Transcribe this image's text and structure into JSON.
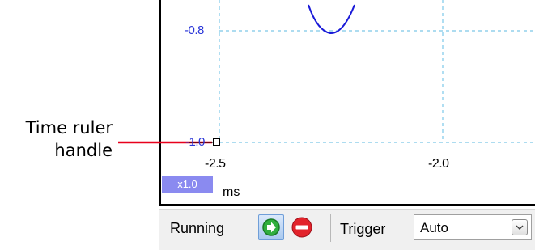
{
  "plot": {
    "y_ticks": [
      "-0.8",
      "-1.0"
    ],
    "x_ticks": [
      "-2.5",
      "-2.0"
    ],
    "zoom": "x1.0",
    "x_unit": "ms",
    "trace_color": "#1a1ad8",
    "grid_color": "#7cc8e8"
  },
  "annotation": {
    "line1": "Time ruler",
    "line2": "handle",
    "arrow_color": "#e8001c"
  },
  "toolbar": {
    "status": "Running",
    "trigger_label": "Trigger",
    "trigger_value": "Auto",
    "run_icon": "green-go-icon",
    "stop_icon": "red-stop-icon"
  }
}
